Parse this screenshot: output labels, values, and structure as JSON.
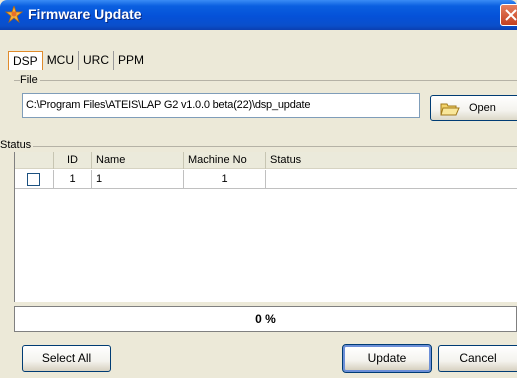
{
  "window": {
    "title": "Firmware Update",
    "icon": "app-star-icon",
    "close_icon": "close-icon"
  },
  "tabs": [
    {
      "label": "DSP",
      "active": true
    },
    {
      "label": "MCU",
      "active": false
    },
    {
      "label": "URC",
      "active": false
    },
    {
      "label": "PPM",
      "active": false
    }
  ],
  "file_group": {
    "label": "File",
    "path": "C:\\Program Files\\ATEIS\\LAP G2 v1.0.0 beta(22)\\dsp_update",
    "open_label": "Open",
    "open_icon": "folder-open-icon"
  },
  "status_group": {
    "label": "Status"
  },
  "table": {
    "columns": [
      "",
      "ID",
      "Name",
      "Machine No",
      "Status"
    ],
    "rows": [
      {
        "checked": false,
        "id": "1",
        "name": "1",
        "machine_no": "1",
        "status": ""
      }
    ]
  },
  "progress": {
    "value": 0,
    "text": "0 %"
  },
  "buttons": {
    "select_all": "Select All",
    "update": "Update",
    "cancel": "Cancel"
  },
  "colors": {
    "title_bar": "#0551d8",
    "close_button": "#d2522c",
    "active_tab_border": "#e08b2b",
    "window_background": "#ece9d8"
  }
}
